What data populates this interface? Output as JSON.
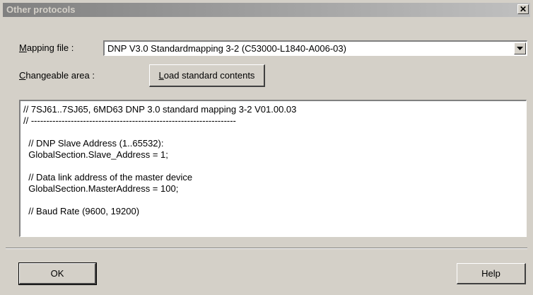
{
  "window": {
    "title": "Other protocols",
    "close_icon": "close-icon"
  },
  "mapping": {
    "label_accel": "M",
    "label_rest": "apping file :",
    "value": "DNP V3.0 Standardmapping 3-2 (C53000-L1840-A006-03)",
    "dropdown_icon": "chevron-down-icon"
  },
  "changeable": {
    "label_accel": "C",
    "label_rest": "hangeable area :",
    "load_accel": "L",
    "load_rest": "oad standard contents"
  },
  "editor": {
    "lines": [
      "// 7SJ61..7SJ65, 6MD63 DNP 3.0 standard mapping 3-2 V01.00.03",
      "// -------------------------------------------------------------------",
      "",
      "  // DNP Slave Address (1..65532):",
      "  GlobalSection.Slave_Address = 1;",
      "",
      "  // Data link address of the master device",
      "  GlobalSection.MasterAddress = 100;",
      "",
      "  // Baud Rate (9600, 19200)"
    ]
  },
  "footer": {
    "ok_label": "OK",
    "help_label": "Help"
  }
}
